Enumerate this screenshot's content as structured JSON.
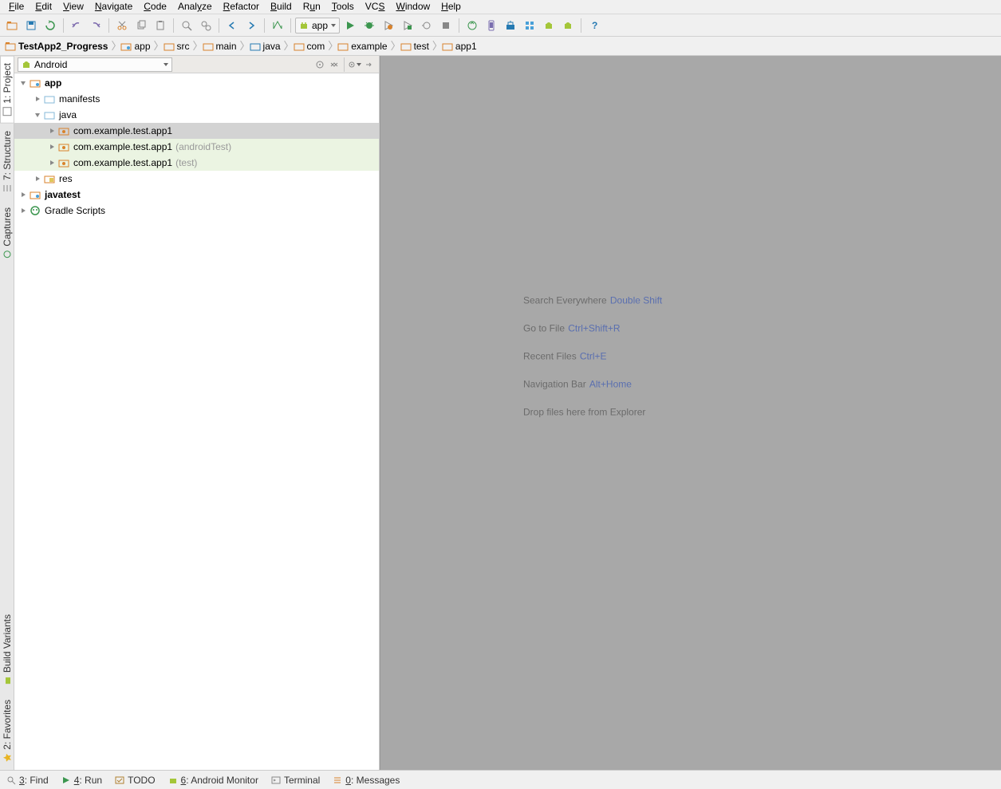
{
  "menu": [
    "File",
    "Edit",
    "View",
    "Navigate",
    "Code",
    "Analyze",
    "Refactor",
    "Build",
    "Run",
    "Tools",
    "VCS",
    "Window",
    "Help"
  ],
  "menu_underline": [
    0,
    0,
    0,
    0,
    0,
    4,
    0,
    0,
    1,
    0,
    2,
    0,
    0
  ],
  "run_config": "app",
  "breadcrumb": [
    "TestApp2_Progress",
    "app",
    "src",
    "main",
    "java",
    "com",
    "example",
    "test",
    "app1"
  ],
  "panel": {
    "mode": "Android"
  },
  "left_tabs": [
    "1: Project",
    "7: Structure",
    "Captures",
    "Build Variants",
    "2: Favorites"
  ],
  "tree": {
    "root": "app",
    "manifests": "manifests",
    "java": "java",
    "pkg1": "com.example.test.app1",
    "pkg2": "com.example.test.app1",
    "pkg2_suffix": "(androidTest)",
    "pkg3": "com.example.test.app1",
    "pkg3_suffix": "(test)",
    "res": "res",
    "javatest": "javatest",
    "gradle": "Gradle Scripts"
  },
  "hints": [
    {
      "text": "Search Everywhere",
      "kbd": "Double Shift"
    },
    {
      "text": "Go to File",
      "kbd": "Ctrl+Shift+R"
    },
    {
      "text": "Recent Files",
      "kbd": "Ctrl+E"
    },
    {
      "text": "Navigation Bar",
      "kbd": "Alt+Home"
    },
    {
      "text": "Drop files here from Explorer",
      "kbd": ""
    }
  ],
  "bottom": {
    "find": "3: Find",
    "run": "4: Run",
    "todo": "TODO",
    "monitor": "6: Android Monitor",
    "terminal": "Terminal",
    "messages": "0: Messages"
  }
}
